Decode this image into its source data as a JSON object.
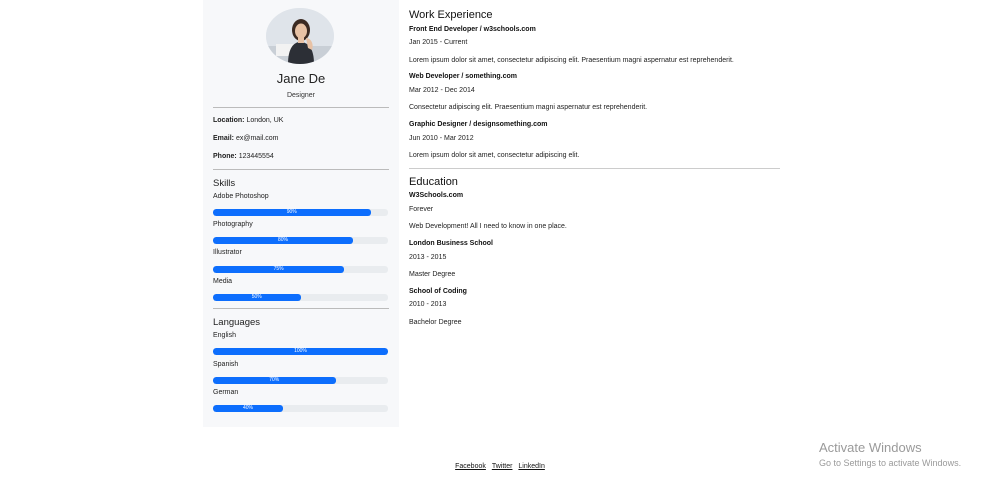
{
  "profile": {
    "name": "Jane De",
    "role": "Designer",
    "location_label": "Location:",
    "location": "London, UK",
    "email_label": "Email:",
    "email": "ex@mail.com",
    "phone_label": "Phone:",
    "phone": "123445554"
  },
  "skills": {
    "title": "Skills",
    "items": [
      {
        "label": "Adobe Photoshop",
        "level": 90,
        "text": "90%"
      },
      {
        "label": "Photography",
        "level": 80,
        "text": "80%"
      },
      {
        "label": "Illustrator",
        "level": 75,
        "text": "75%"
      },
      {
        "label": "Media",
        "level": 50,
        "text": "50%"
      }
    ]
  },
  "languages": {
    "title": "Languages",
    "items": [
      {
        "label": "English",
        "level": 100,
        "text": "100%"
      },
      {
        "label": "Spanish",
        "level": 70,
        "text": "70%"
      },
      {
        "label": "German",
        "level": 40,
        "text": "40%"
      }
    ]
  },
  "work": {
    "title": "Work Experience",
    "items": [
      {
        "title": "Front End Developer / w3schools.com",
        "period": "Jan 2015 - Current",
        "desc": "Lorem ipsum dolor sit amet, consectetur adipiscing elit. Praesentium magni aspernatur est reprehenderit."
      },
      {
        "title": "Web Developer / something.com",
        "period": "Mar 2012 - Dec 2014",
        "desc": "Consectetur adipiscing elit. Praesentium magni aspernatur est reprehenderit."
      },
      {
        "title": "Graphic Designer / designsomething.com",
        "period": "Jun 2010 - Mar 2012",
        "desc": "Lorem ipsum dolor sit amet, consectetur adipiscing elit."
      }
    ]
  },
  "education": {
    "title": "Education",
    "items": [
      {
        "title": "W3Schools.com",
        "period": "Forever",
        "desc": "Web Development! All I need to know in one place."
      },
      {
        "title": "London Business School",
        "period": "2013 - 2015",
        "desc": "Master Degree"
      },
      {
        "title": "School of Coding",
        "period": "2010 - 2013",
        "desc": "Bachelor Degree"
      }
    ]
  },
  "footer": {
    "facebook": "Facebook",
    "twitter": "Twitter",
    "linkedin": "LinkedIn"
  },
  "watermark": {
    "title": "Activate Windows",
    "subtitle": "Go to Settings to activate Windows."
  },
  "colors": {
    "accent": "#0d6efd",
    "sidebar_bg": "#f7f8fa"
  }
}
